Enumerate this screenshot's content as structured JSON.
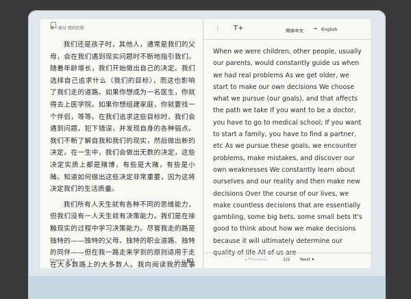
{
  "left_page": {
    "header": "第一部分 我的历程",
    "paragraphs": [
      "我们还是孩子时，其他人，通常是我们的父母，会在我们遇到现实问题时不断地指引我们。随着年龄增长，我们开始做出自己的决定。我们选择自己追求什么（我们的目标），而这也影响了我们走的道路。如果你想成为一名医生，你就得去上医学院。如果你想组建家庭，你就要找一个伴侣，等等。在我们追求这些目标时，我们会遇到问题，犯下错误，并发现自身的各种弱点。我们不断了解自我和我们的现实，然后做出新的决定。在一生中，我们会做出无数的决定，这些决定实质上都是赌博，有些是大赌，有些是小赌。知道如何做出这些决定非常重要，因为这将决定我们的生活质量。",
      "我们所有人天生就有各种不同的思维能力，但我们没有一人天生就有决策能力。我们是在接触现实的过程中学习决策能力。尽管我走的路是独特的——独特的父母、独特的职业道路、独特的同伴——但在我一路走来学到的原则适用于走在大多数路上的大多数人。我向阅读我的故事时，请尽量透过"
    ],
    "footer_chapter": "Chapter 4/47",
    "footer_time": "15:25"
  },
  "toolbar": {
    "font_decrease": "T-",
    "font_increase": "T+",
    "source_lang": "简体中文",
    "arrow": "→",
    "target_lang": "English"
  },
  "right_page": {
    "text": "When we were children, other people, usually our parents, would constantly guide us when we had real problems As we get older, we start to make our own decisions We choose what we pursue (our goals), and that affects the path we take If you want to be a doctor, you have to go to medical school; If you want to start a family, you have to find a partner, etc As we pursue these goals, we encounter problems, make mistakes, and discover our own weaknesses We constantly learn about ourselves and our reality and then make new decisions Over the course of our lives, we make countless decisions that are essentially gambling, some big bets, some small bets It's good to think about how we make decisions because it will ultimately determine our quality of life All of us are"
  },
  "pager": {
    "prev_label": "◂ Previous",
    "page": "1/2",
    "next_label": "Next ▾"
  }
}
